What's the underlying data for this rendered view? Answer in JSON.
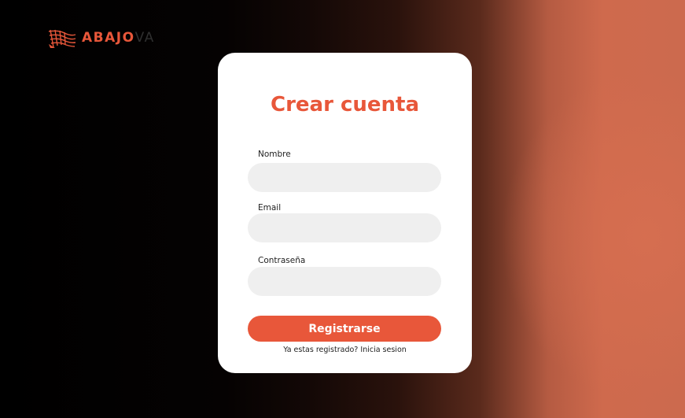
{
  "brand": {
    "name_primary": "ABAJO",
    "name_secondary": "VA",
    "logo_icon": "grid-wave-logo-icon",
    "accent_color": "#e8573a"
  },
  "form": {
    "title": "Crear cuenta",
    "fields": [
      {
        "label": "Nombre",
        "value": "",
        "placeholder": ""
      },
      {
        "label": "Email",
        "value": "",
        "placeholder": ""
      },
      {
        "label": "Contraseña",
        "value": "",
        "placeholder": ""
      }
    ],
    "submit_label": "Registrarse",
    "login_prompt": "Ya estas registrado?",
    "login_link": "Inicia sesion"
  }
}
